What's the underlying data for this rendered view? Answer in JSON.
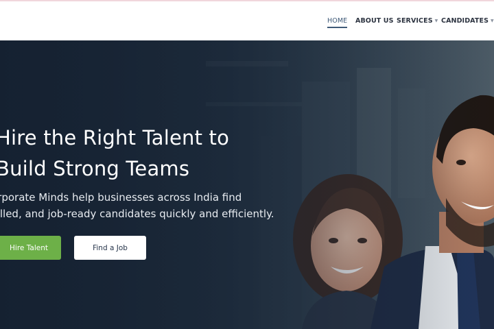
{
  "nav": {
    "items": [
      {
        "label": "HOME",
        "active": true
      },
      {
        "label": "ABOUT US",
        "active": false
      },
      {
        "label": "SERVICES",
        "active": false,
        "dropdown": true
      },
      {
        "label": "CANDIDATES",
        "active": false,
        "dropdown": true
      }
    ]
  },
  "hero": {
    "title_line1": "Hire the Right Talent to",
    "title_line2": "Build Strong Teams",
    "subtitle_line1": "orporate Minds help businesses across India find",
    "subtitle_line2": "killed, and job-ready candidates quickly and efficiently.",
    "primary_cta": "Hire Talent",
    "secondary_cta": "Find a Job",
    "image": "photo of smiling businessman in navy suit and businesswoman"
  },
  "colors": {
    "accent_green": "#6db048",
    "nav_active": "#3f5a78",
    "hero_overlay": "#1f2d3c"
  }
}
